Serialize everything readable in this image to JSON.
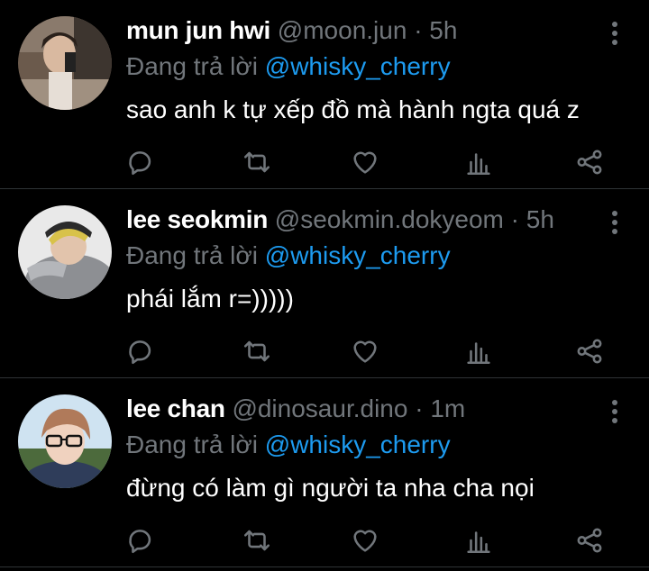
{
  "replies": [
    {
      "display_name": "mun jun hwi",
      "handle": "@moon.jun",
      "separator": "·",
      "time": "5h",
      "replying_prefix": "Đang trả lời",
      "replying_to": "@whisky_cherry",
      "text": "sao anh k tự xếp đồ mà hành ngta quá z"
    },
    {
      "display_name": "lee seokmin",
      "handle": "@seokmin.dokyeom",
      "separator": "·",
      "time": "5h",
      "replying_prefix": "Đang trả lời",
      "replying_to": "@whisky_cherry",
      "text": "phái lắm r=)))))"
    },
    {
      "display_name": "lee chan",
      "handle": "@dinosaur.dino",
      "separator": "·",
      "time": "1m",
      "replying_prefix": "Đang trả lời",
      "replying_to": "@whisky_cherry",
      "text": "đừng có làm gì người ta nha cha nọi"
    }
  ],
  "icons": [
    "more-vertical-icon",
    "reply-icon",
    "retweet-icon",
    "like-icon",
    "analytics-icon",
    "share-icon"
  ],
  "colors": {
    "background": "#000000",
    "text": "#ffffff",
    "muted": "#71767b",
    "mention": "#1d9bf0",
    "divider": "#2f3336"
  }
}
